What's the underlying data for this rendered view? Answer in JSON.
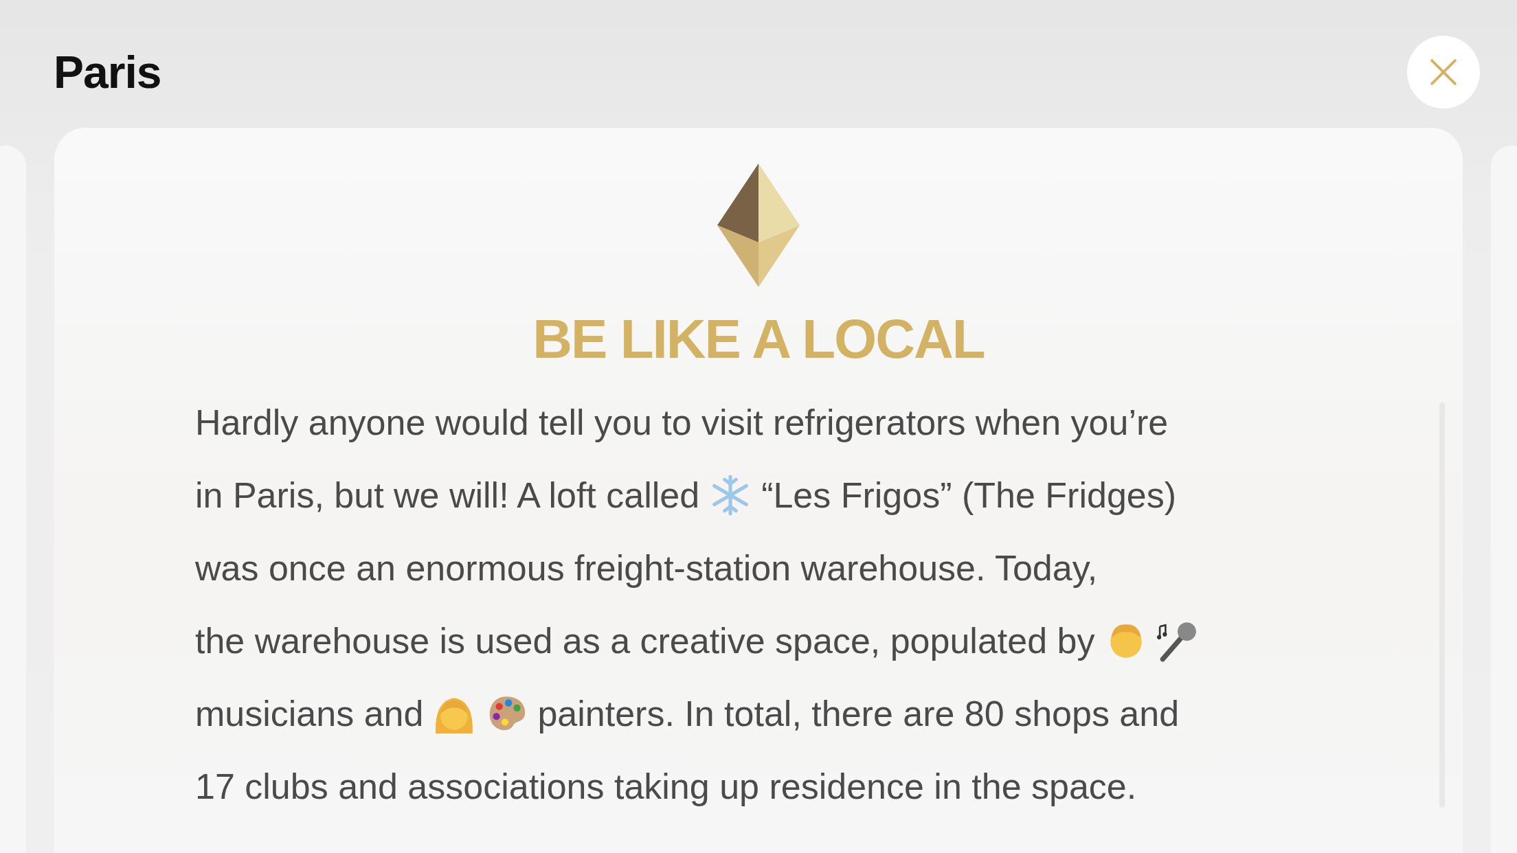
{
  "header": {
    "title": "Paris"
  },
  "card": {
    "heading": "BE LIKE A LOCAL",
    "lines": [
      [
        {
          "kind": "text",
          "text": "Hardly anyone would tell you to visit refrigerators when you’re"
        }
      ],
      [
        {
          "kind": "text",
          "text": "in Paris, but we will! A loft called"
        },
        {
          "kind": "snowflake"
        },
        {
          "kind": "text",
          "text": "“Les Frigos” (The Fridges)"
        }
      ],
      [
        {
          "kind": "text",
          "text": "was once an enormous freight-station warehouse. Today,"
        }
      ],
      [
        {
          "kind": "text",
          "text": "the warehouse is used as a creative space, populated by"
        },
        {
          "kind": "man"
        },
        {
          "kind": "microphone"
        }
      ],
      [
        {
          "kind": "text",
          "text": "musicians and"
        },
        {
          "kind": "woman"
        },
        {
          "kind": "palette"
        },
        {
          "kind": "text",
          "text": "painters. In total, there are 80 shops and"
        }
      ],
      [
        {
          "kind": "text",
          "text": "17 clubs and associations taking up residence in the space."
        }
      ]
    ]
  }
}
